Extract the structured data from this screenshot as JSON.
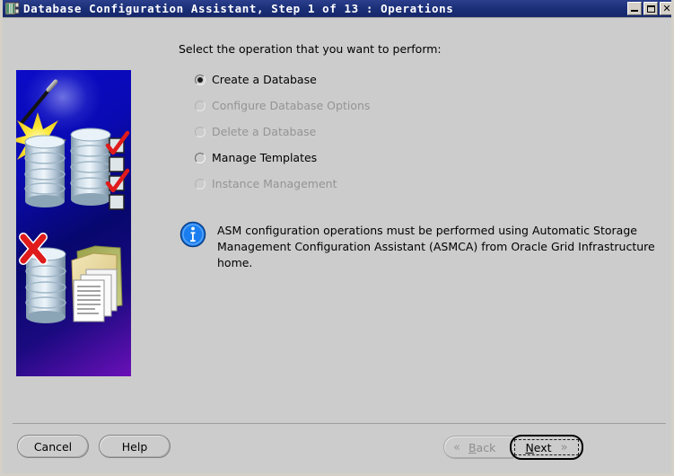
{
  "window": {
    "title": "Database Configuration Assistant, Step 1 of 13 : Operations",
    "icon": "database-app-icon",
    "controls": {
      "minimize": "_",
      "maximize": "□",
      "close": "✕"
    }
  },
  "main": {
    "prompt": "Select the operation that you want to perform:",
    "options": [
      {
        "label": "Create a Database",
        "selected": true,
        "enabled": true
      },
      {
        "label": "Configure Database Options",
        "selected": false,
        "enabled": false
      },
      {
        "label": "Delete a Database",
        "selected": false,
        "enabled": false
      },
      {
        "label": "Manage Templates",
        "selected": false,
        "enabled": true
      },
      {
        "label": "Instance Management",
        "selected": false,
        "enabled": false
      }
    ],
    "note": {
      "icon": "info-icon",
      "text": "ASM configuration operations must be performed using Automatic Storage\nManagement Configuration Assistant (ASMCA) from Oracle Grid Infrastructure home."
    }
  },
  "artwork": {
    "name": "database-wizard-illustration",
    "elements": [
      "magic-wand",
      "star-sparkle",
      "database-cylinder",
      "checklist-checkmarks",
      "red-x-delete",
      "folder-documents"
    ]
  },
  "footer": {
    "cancel_label": "Cancel",
    "help_label": "Help",
    "back": {
      "label": "Back",
      "mnemonic": "B",
      "enabled": false,
      "icon": "chevron-left-double-icon"
    },
    "next": {
      "label": "Next",
      "mnemonic": "N",
      "enabled": true,
      "focused": true,
      "icon": "chevron-right-double-icon"
    }
  },
  "colors": {
    "titlebar": "#1b2f78",
    "dialog_bg": "#cccccc",
    "artwork_blue": "#0b0bc8",
    "artwork_purple": "#6a10b8",
    "info_blue": "#1a7ef0",
    "check_red": "#e01b1b",
    "star_yellow": "#f5e020"
  }
}
